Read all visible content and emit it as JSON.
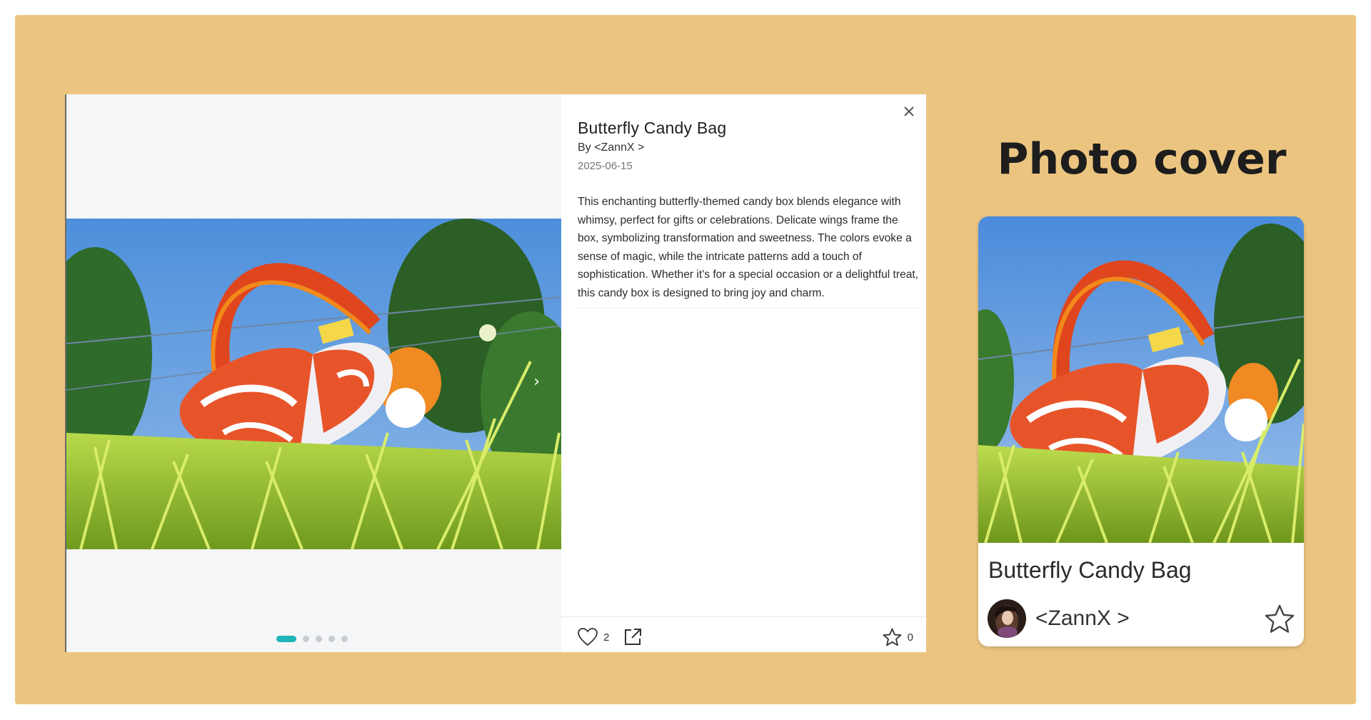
{
  "modal": {
    "title": "Butterfly Candy Bag",
    "author": "By <ZannX >",
    "date": "2025-06-15",
    "description": "This enchanting butterfly-themed candy box blends elegance with whimsy, perfect for gifts or celebrations. Delicate wings frame the box, symbolizing transformation and sweetness. The colors evoke a sense of magic, while the intricate patterns add a touch of sophistication. Whether it's for a special occasion or a delightful treat, this candy box is designed to bring joy and charm.",
    "close_icon": "close-icon",
    "next_icon": "chevron-right-icon",
    "carousel": {
      "total": 5,
      "active_index": 0
    },
    "actions": {
      "like_icon": "heart-icon",
      "like_count": "2",
      "share_icon": "share-icon",
      "favorite_icon": "star-icon",
      "favorite_count": "0"
    }
  },
  "section": {
    "title": "Photo cover"
  },
  "card": {
    "title": "Butterfly Candy Bag",
    "author": "<ZannX >",
    "avatar_icon": "avatar",
    "favorite_icon": "star-icon"
  },
  "colors": {
    "background": "#ebc580",
    "accent": "#1fb4b8",
    "gallery_bg": "#f5f6f8"
  }
}
